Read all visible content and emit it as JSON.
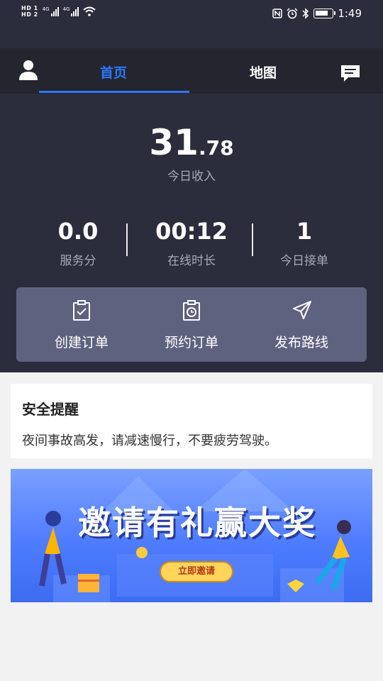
{
  "status_bar": {
    "sim1": "HD 1",
    "sim2": "HD 2",
    "net1": "4G",
    "net2": "4G",
    "time": "1:49",
    "battery_level": 0.75
  },
  "nav": {
    "tabs": [
      {
        "label": "首页",
        "active": true
      },
      {
        "label": "地图",
        "active": false
      }
    ],
    "accent_color": "#2e77ff"
  },
  "income": {
    "integer": "31",
    "decimal": ".78",
    "label": "今日收入"
  },
  "stats": [
    {
      "value": "0.0",
      "label": "服务分"
    },
    {
      "value": "00:12",
      "label": "在线时长"
    },
    {
      "value": "1",
      "label": "今日接单"
    }
  ],
  "actions": [
    {
      "label": "创建订单",
      "icon": "clipboard-check-icon"
    },
    {
      "label": "预约订单",
      "icon": "clipboard-clock-icon"
    },
    {
      "label": "发布路线",
      "icon": "paper-plane-icon"
    }
  ],
  "safety": {
    "title": "安全提醒",
    "text": "夜间事故高发，请减速慢行，不要疲劳驾驶。"
  },
  "banner": {
    "title": "邀请有礼赢大奖",
    "button": "立即邀请"
  }
}
